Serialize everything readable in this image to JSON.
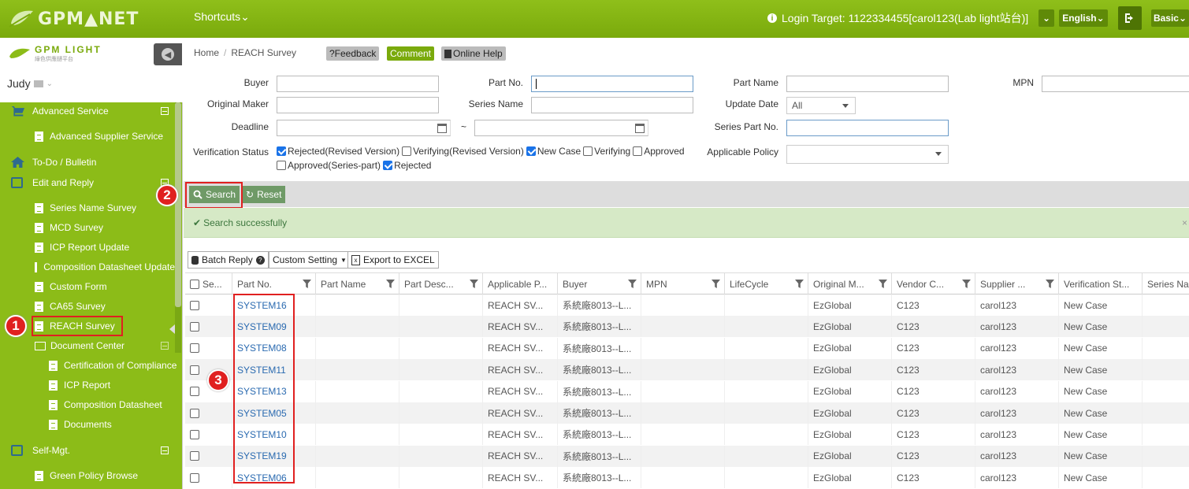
{
  "header": {
    "logo_text": "GPM▲NET",
    "shortcuts": "Shortcuts",
    "login_target": "Login Target: 1122334455[carol123(Lab light站台)]",
    "language": "English",
    "basic": "Basic"
  },
  "sidebar": {
    "logo_text": "GPM LIGHT",
    "logo_sub": "綠色供應鏈平台",
    "user": "Judy",
    "items": [
      {
        "label": "Advanced Service"
      },
      {
        "label": "Advanced Supplier Service"
      },
      {
        "label": "To-Do / Bulletin"
      },
      {
        "label": "Edit and Reply"
      },
      {
        "label": "Series Name Survey"
      },
      {
        "label": "MCD Survey"
      },
      {
        "label": "ICP Report Update"
      },
      {
        "label": "Composition Datasheet Update"
      },
      {
        "label": "Custom Form"
      },
      {
        "label": "CA65 Survey"
      },
      {
        "label": "REACH Survey"
      },
      {
        "label": "Document Center"
      },
      {
        "label": "Certification of Compliance"
      },
      {
        "label": "ICP Report"
      },
      {
        "label": "Composition Datasheet"
      },
      {
        "label": "Documents"
      },
      {
        "label": "Self-Mgt."
      },
      {
        "label": "Green Policy Browse"
      }
    ]
  },
  "breadcrumb": {
    "home": "Home",
    "sep": "/",
    "current": "REACH Survey"
  },
  "actions": {
    "feedback": "?Feedback",
    "comment": "Comment",
    "help": "Online Help"
  },
  "form": {
    "buyer": "Buyer",
    "part_no": "Part No.",
    "part_name": "Part Name",
    "mpn": "MPN",
    "original_maker": "Original Maker",
    "series_name": "Series Name",
    "update_date": "Update Date",
    "update_date_value": "All",
    "deadline": "Deadline",
    "tilde": "~",
    "series_part_no": "Series Part No.",
    "verification_status": "Verification Status",
    "applicable_policy": "Applicable Policy",
    "statuses": [
      {
        "label": "Rejected(Revised Version)"
      },
      {
        "label": "Verifying(Revised Version)"
      },
      {
        "label": "New Case"
      },
      {
        "label": "Verifying"
      },
      {
        "label": "Approved"
      },
      {
        "label": "Approved(Series-part)"
      },
      {
        "label": "Rejected"
      }
    ]
  },
  "buttons": {
    "search": "Search",
    "reset": "Reset"
  },
  "message": "Search successfully",
  "toolbar": {
    "batch_reply": "Batch Reply",
    "custom_setting": "Custom Setting",
    "export": "Export to EXCEL"
  },
  "grid": {
    "columns": [
      "Se...",
      "Part No.",
      "Part Name",
      "Part Desc...",
      "Applicable P...",
      "Buyer",
      "MPN",
      "LifeCycle",
      "Original M...",
      "Vendor C...",
      "Supplier ...",
      "Verification St...",
      "Series Na"
    ],
    "rows": [
      [
        "SYSTEM16",
        "REACH SV...",
        "系統廠8013--L...",
        "EzGlobal",
        "C123",
        "carol123",
        "New Case"
      ],
      [
        "SYSTEM09",
        "REACH SV...",
        "系統廠8013--L...",
        "EzGlobal",
        "C123",
        "carol123",
        "New Case"
      ],
      [
        "SYSTEM08",
        "REACH SV...",
        "系統廠8013--L...",
        "EzGlobal",
        "C123",
        "carol123",
        "New Case"
      ],
      [
        "SYSTEM11",
        "REACH SV...",
        "系統廠8013--L...",
        "EzGlobal",
        "C123",
        "carol123",
        "New Case"
      ],
      [
        "SYSTEM13",
        "REACH SV...",
        "系統廠8013--L...",
        "EzGlobal",
        "C123",
        "carol123",
        "New Case"
      ],
      [
        "SYSTEM05",
        "REACH SV...",
        "系統廠8013--L...",
        "EzGlobal",
        "C123",
        "carol123",
        "New Case"
      ],
      [
        "SYSTEM10",
        "REACH SV...",
        "系統廠8013--L...",
        "EzGlobal",
        "C123",
        "carol123",
        "New Case"
      ],
      [
        "SYSTEM19",
        "REACH SV...",
        "系統廠8013--L...",
        "EzGlobal",
        "C123",
        "carol123",
        "New Case"
      ],
      [
        "SYSTEM06",
        "REACH SV...",
        "系統廠8013--L...",
        "EzGlobal",
        "C123",
        "carol123",
        "New Case"
      ]
    ]
  },
  "annotations": {
    "one": "1",
    "two": "2",
    "three": "3"
  },
  "colors": {
    "brand": "#8cbc18",
    "highlight": "#e02020",
    "link": "#2a6ab0"
  }
}
